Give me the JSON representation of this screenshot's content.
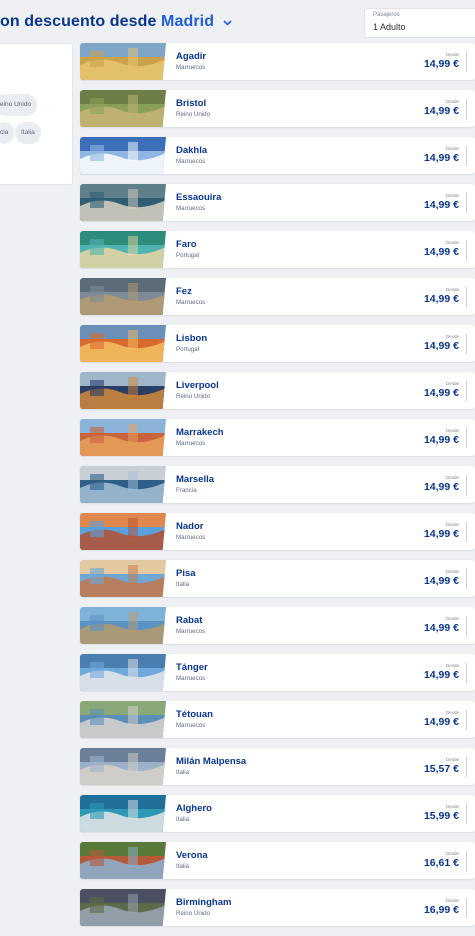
{
  "header": {
    "title_prefix": "on descuento desde",
    "city": "Madrid",
    "passengers_label": "Pasajeros",
    "passengers_value": "1 Adulto"
  },
  "filters": {
    "chips": [
      "eino Unido",
      "cia",
      "Italia"
    ]
  },
  "destinations": [
    {
      "city": "Agadir",
      "country": "Marruecos",
      "from": "Desde",
      "price": "14,99 €"
    },
    {
      "city": "Bristol",
      "country": "Reino Unido",
      "from": "Desde",
      "price": "14,99 €"
    },
    {
      "city": "Dakhla",
      "country": "Marruecos",
      "from": "Desde",
      "price": "14,99 €"
    },
    {
      "city": "Essaouira",
      "country": "Marruecos",
      "from": "Desde",
      "price": "14,99 €"
    },
    {
      "city": "Faro",
      "country": "Portugal",
      "from": "Desde",
      "price": "14,99 €"
    },
    {
      "city": "Fez",
      "country": "Marruecos",
      "from": "Desde",
      "price": "14,99 €"
    },
    {
      "city": "Lisbon",
      "country": "Portugal",
      "from": "Desde",
      "price": "14,99 €"
    },
    {
      "city": "Liverpool",
      "country": "Reino Unido",
      "from": "Desde",
      "price": "14,99 €"
    },
    {
      "city": "Marrakech",
      "country": "Marruecos",
      "from": "Desde",
      "price": "14,99 €"
    },
    {
      "city": "Marsella",
      "country": "Francia",
      "from": "Desde",
      "price": "14,99 €"
    },
    {
      "city": "Nador",
      "country": "Marruecos",
      "from": "Desde",
      "price": "14,99 €"
    },
    {
      "city": "Pisa",
      "country": "Italia",
      "from": "Desde",
      "price": "14,99 €"
    },
    {
      "city": "Rabat",
      "country": "Marruecos",
      "from": "Desde",
      "price": "14,99 €"
    },
    {
      "city": "Tánger",
      "country": "Marruecos",
      "from": "Desde",
      "price": "14,99 €"
    },
    {
      "city": "Tétouan",
      "country": "Marruecos",
      "from": "Desde",
      "price": "14,99 €"
    },
    {
      "city": "Milán Malpensa",
      "country": "Italia",
      "from": "Desde",
      "price": "15,57 €"
    },
    {
      "city": "Alghero",
      "country": "Italia",
      "from": "Desde",
      "price": "15,99 €"
    },
    {
      "city": "Verona",
      "country": "Italia",
      "from": "Desde",
      "price": "16,61 €"
    },
    {
      "city": "Birmingham",
      "country": "Reino Unido",
      "from": "Desde",
      "price": "16,99 €"
    }
  ],
  "photo_palettes": [
    [
      "#c9a24c",
      "#e8c670",
      "#7fa6c9"
    ],
    [
      "#8aa05a",
      "#c8b476",
      "#6d7f46"
    ],
    [
      "#8fb6e2",
      "#ffffff",
      "#3d6fb8"
    ],
    [
      "#2e5d74",
      "#d9d2c3",
      "#5f7f8a"
    ],
    [
      "#4fb3b0",
      "#e9d6a2",
      "#2e8c7c"
    ],
    [
      "#7d8a98",
      "#b89c6e",
      "#5b6b78"
    ],
    [
      "#d96a2d",
      "#f2c063",
      "#6a8fb8"
    ],
    [
      "#2b3f66",
      "#d28a3a",
      "#9fb5c9"
    ],
    [
      "#c8643b",
      "#e8a15e",
      "#8bb2d9"
    ],
    [
      "#2f5e86",
      "#a4c2d9",
      "#c9cfd6"
    ],
    [
      "#5aa0dd",
      "#b5502f",
      "#e0884e"
    ],
    [
      "#6ea6d6",
      "#c4764a",
      "#e2c9a0"
    ],
    [
      "#5a92c3",
      "#b99a6c",
      "#7fb2d8"
    ],
    [
      "#6fa8dc",
      "#e9e9e9",
      "#4a7db0"
    ],
    [
      "#5c8fb8",
      "#d9d4cc",
      "#8aa877"
    ],
    [
      "#9bb1c9",
      "#d7d2c8",
      "#6b7f98"
    ],
    [
      "#2e98b5",
      "#e6e6e6",
      "#1f6f9a"
    ],
    [
      "#b45a3a",
      "#8cb2d4",
      "#5a7a3a"
    ],
    [
      "#5d6b4a",
      "#9aa7b8",
      "#4a5060"
    ]
  ]
}
